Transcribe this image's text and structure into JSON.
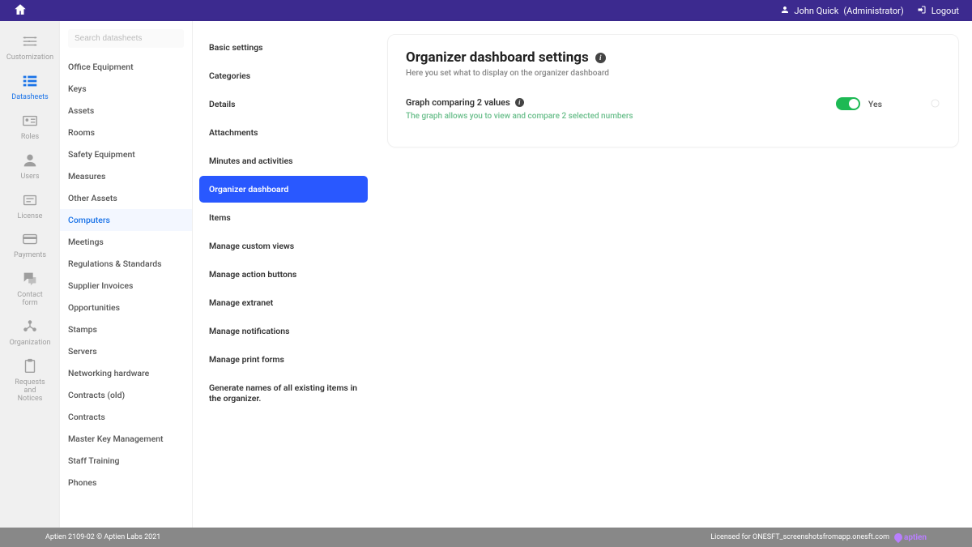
{
  "topbar": {
    "user_name": "John Quick",
    "user_role": "(Administrator)",
    "logout_label": "Logout"
  },
  "nav_rail": [
    {
      "key": "customization",
      "label": "Customization",
      "icon": "sliders",
      "active": false
    },
    {
      "key": "datasheets",
      "label": "Datasheets",
      "icon": "list",
      "active": true
    },
    {
      "key": "roles",
      "label": "Roles",
      "icon": "id-card",
      "active": false
    },
    {
      "key": "users",
      "label": "Users",
      "icon": "user",
      "active": false
    },
    {
      "key": "license",
      "label": "License",
      "icon": "license",
      "active": false
    },
    {
      "key": "payments",
      "label": "Payments",
      "icon": "credit-card",
      "active": false
    },
    {
      "key": "contact",
      "label": "Contact form",
      "icon": "chat",
      "active": false
    },
    {
      "key": "organization",
      "label": "Organization",
      "icon": "org",
      "active": false
    },
    {
      "key": "requests",
      "label": "Requests and Notices",
      "icon": "clipboard",
      "active": false
    }
  ],
  "datasheets": {
    "search_placeholder": "Search datasheets",
    "items": [
      "Office Equipment",
      "Keys",
      "Assets",
      "Rooms",
      "Safety Equipment",
      "Measures",
      "Other Assets",
      "Computers",
      "Meetings",
      "Regulations & Standards",
      "Supplier Invoices",
      "Opportunities",
      "Stamps",
      "Servers",
      "Networking hardware",
      "Contracts (old)",
      "Contracts",
      "Master Key Management",
      "Staff Training",
      "Phones"
    ],
    "active_index": 7
  },
  "settings_menu": {
    "items": [
      "Basic settings",
      "Categories",
      "Details",
      "Attachments",
      "Minutes and activities",
      "Organizer dashboard",
      "Items",
      "Manage custom views",
      "Manage action buttons",
      "Manage extranet",
      "Manage notifications",
      "Manage print forms",
      "Generate names of all existing items in the organizer."
    ],
    "active_index": 5
  },
  "panel": {
    "title": "Organizer dashboard settings",
    "subtitle": "Here you set what to display on the organizer dashboard",
    "setting_label": "Graph comparing 2 values",
    "setting_desc": "The graph allows you to view and compare 2 selected numbers",
    "toggle_state": "Yes"
  },
  "footer": {
    "left": "Aptien 2109-02 © Aptien Labs 2021",
    "right": "Licensed for ONESFT_screenshotsfromapp.onesft.com",
    "brand": "aptien"
  }
}
